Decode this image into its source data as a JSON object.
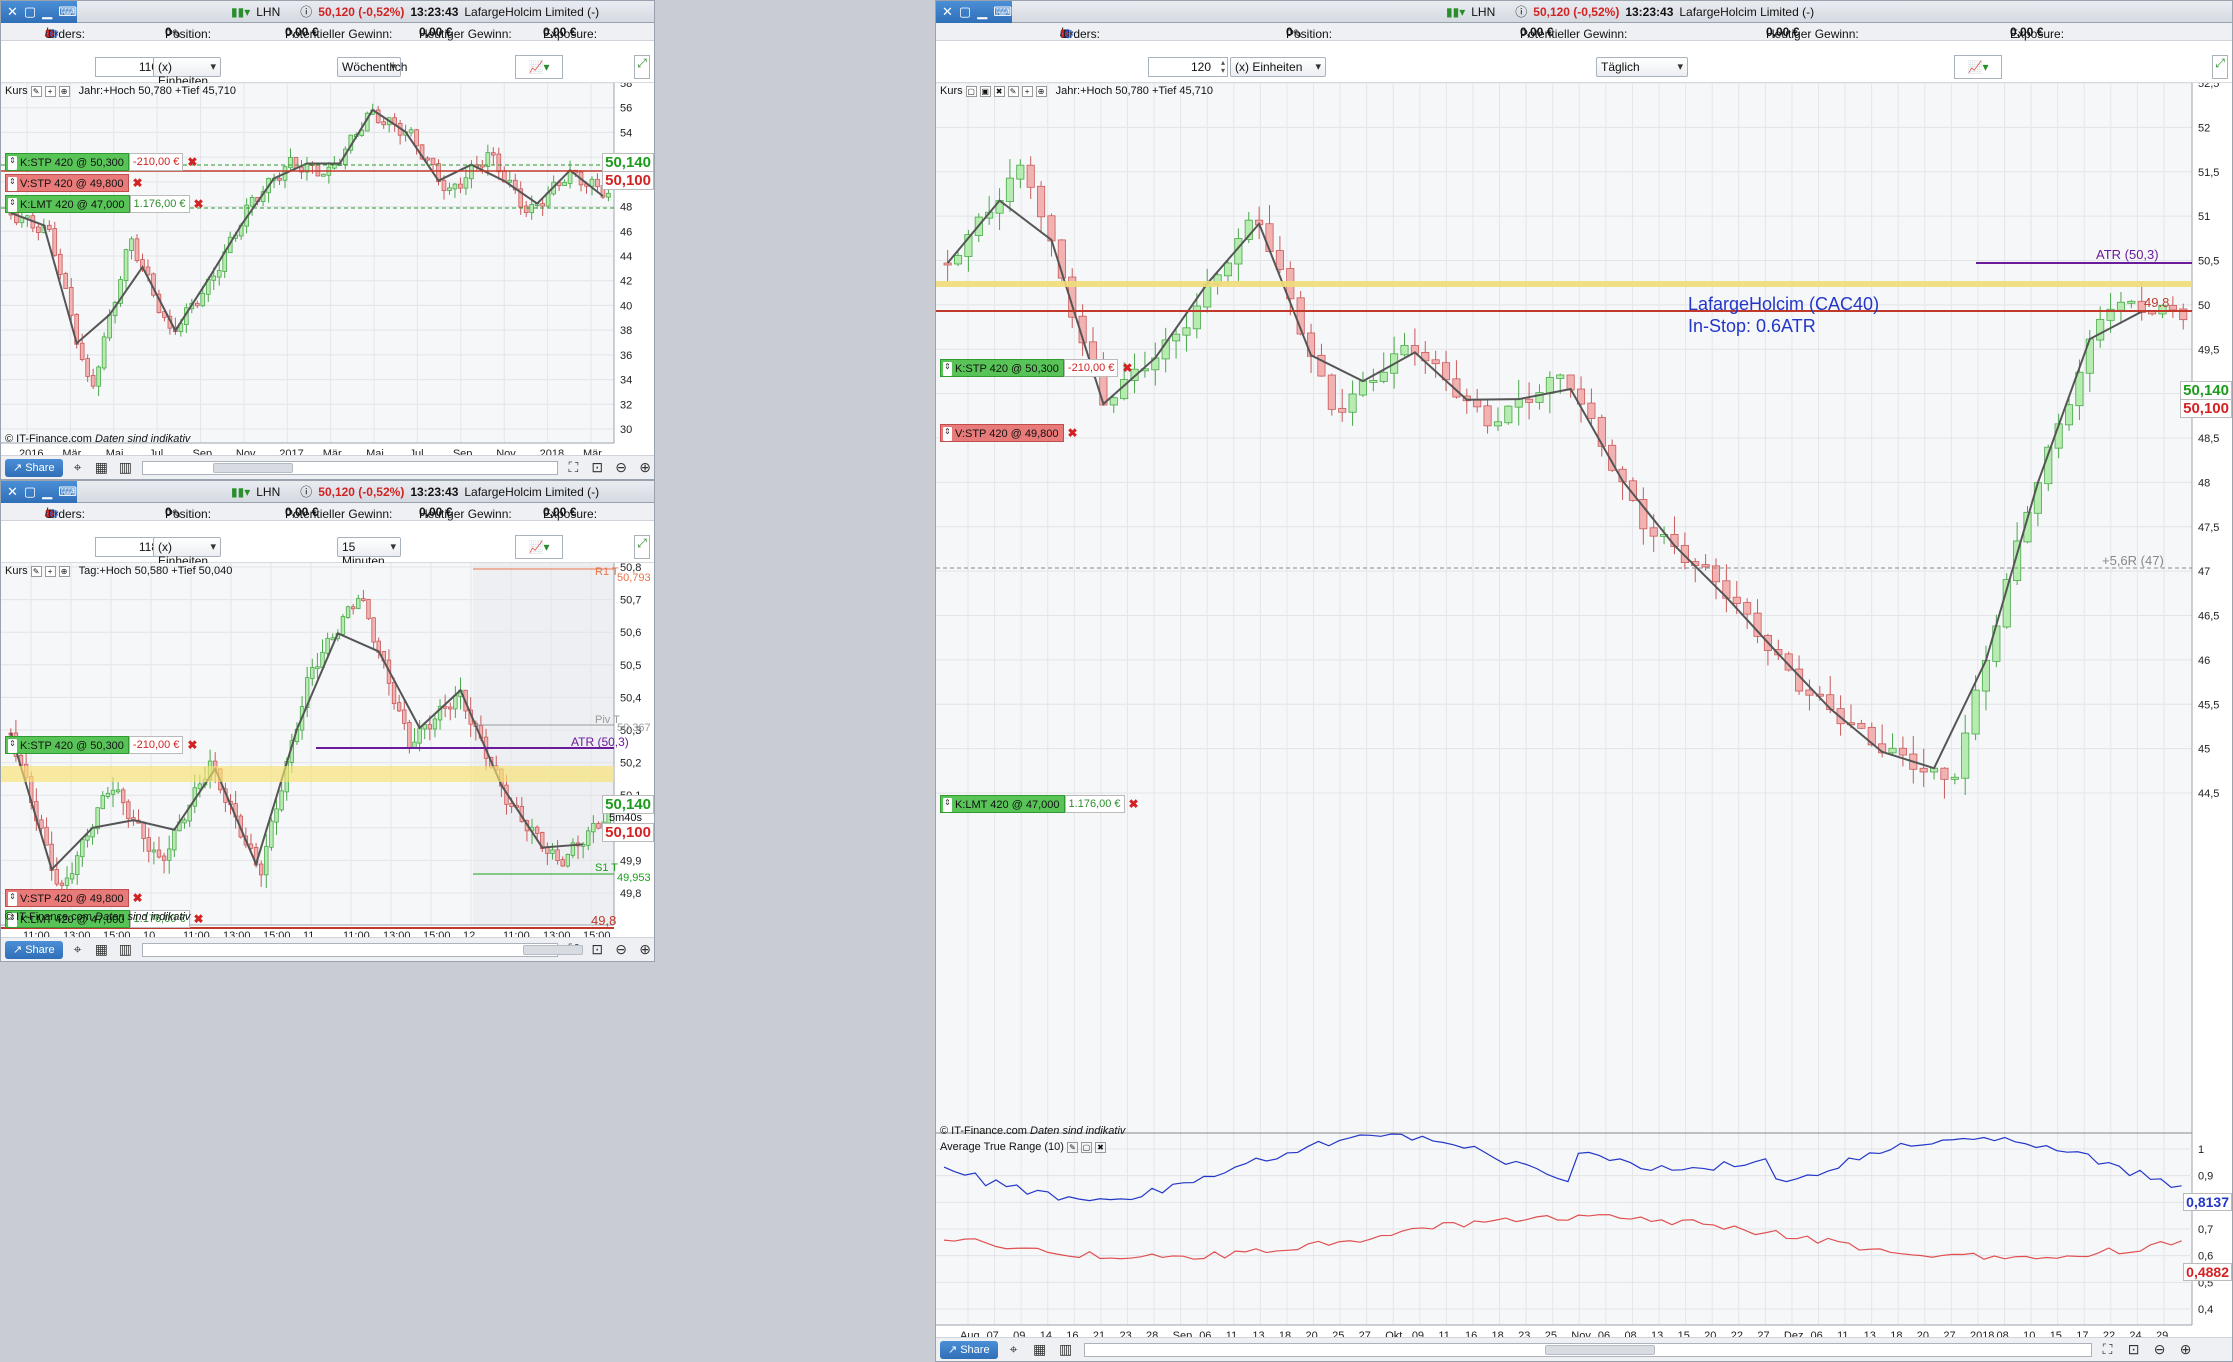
{
  "common": {
    "symbol": "LHN",
    "price": "50,120 (-0,52%)",
    "time": "13:23:43",
    "name": "LafargeHolcim Limited (-)",
    "orders_label": "Orders:",
    "orders_count": "3",
    "orders_zero": "0",
    "position_label": "Position:",
    "position_value": "0",
    "pot_gewinn_label": "Potentieller Gewinn:",
    "pot_gewinn_value": "0,00 €",
    "heute_label": "Heutiger Gewinn:",
    "heute_value": "0,00 €",
    "exposure_label": "Exposure:",
    "exposure_value": "0,00 €",
    "units_label": "(x) Einheiten",
    "kurs_label": "Kurs",
    "share_label": "Share",
    "copyright": "© IT-Finance.com",
    "copyright_note": "Daten sind indikativ",
    "k_stp": "K:STP  420 @ 50,300",
    "k_stp_pnl": "-210,00 €",
    "v_stp": "V:STP  420 @ 49,800",
    "k_lmt": "K:LMT  420 @ 47,000",
    "k_lmt_pnl": "1.176,00 €",
    "price_green": "50,140",
    "price_red": "50,100"
  },
  "pane_weekly": {
    "units_value": "110",
    "timeframe": "Wöchentlich",
    "hilo": "Jahr:+Hoch 50,780 +Tief 45,710",
    "y_ticks": [
      "58",
      "56",
      "54",
      "52",
      "50",
      "48",
      "46",
      "44",
      "42",
      "40",
      "38",
      "36",
      "34",
      "32",
      "30"
    ],
    "x_ticks": [
      "2016",
      "Mär",
      "Mai",
      "Jul",
      "Sep",
      "Nov",
      "2017",
      "Mär",
      "Mai",
      "Jul",
      "Sep",
      "Nov",
      "2018",
      "Mär"
    ]
  },
  "pane_15m": {
    "units_value": "118",
    "timeframe": "15 Minuten",
    "hilo": "Tag:+Hoch 50,580 +Tief 50,040",
    "y_ticks": [
      "50,8",
      "50,7",
      "50,6",
      "50,5",
      "50,4",
      "50,3",
      "50,2",
      "50,1",
      "50",
      "49,9",
      "49,8"
    ],
    "x_ticks": [
      "11:00",
      "13:00",
      "15:00",
      "10",
      "11:00",
      "13:00",
      "15:00",
      "11",
      "11:00",
      "13:00",
      "15:00",
      "12",
      "11:00",
      "13:00",
      "15:00"
    ],
    "r1_label": "R1 T",
    "r1_value": "50,793",
    "piv_label": "Piv T",
    "piv_value": "50,367",
    "atr_label": "ATR (50,3)",
    "s1_label": "S1 T",
    "s1_value": "49,953",
    "countdown": "5m40s",
    "stop_level": "49,8"
  },
  "pane_daily": {
    "units_value": "120",
    "timeframe": "Täglich",
    "hilo": "Jahr:+Hoch 50,780 +Tief 45,710",
    "title": "LafargeHolcim (CAC40)",
    "subtitle": "In-Stop: 0.6ATR",
    "atr_label": "ATR (50,3)",
    "stop_level": "49.8",
    "target_label": "+5,6R (47)",
    "y_ticks": [
      "52,5",
      "52",
      "51,5",
      "51",
      "50,5",
      "50",
      "49,5",
      "49",
      "48,5",
      "48",
      "47,5",
      "47",
      "46,5",
      "46",
      "45,5",
      "45",
      "44,5"
    ],
    "x_ticks": [
      "Aug",
      "07",
      "09",
      "14",
      "16",
      "21",
      "23",
      "28",
      "Sep",
      "06",
      "11",
      "13",
      "18",
      "20",
      "25",
      "27",
      "Okt",
      "09",
      "11",
      "16",
      "18",
      "23",
      "25",
      "Nov",
      "06",
      "08",
      "13",
      "15",
      "20",
      "22",
      "27",
      "Dez",
      "06",
      "11",
      "13",
      "18",
      "20",
      "27",
      "2018",
      "08",
      "10",
      "15",
      "17",
      "22",
      "24",
      "29"
    ],
    "atr_indicator": "Average True Range (10)",
    "atr_ticks": [
      "1",
      "0,9",
      "0,8",
      "0,7",
      "0,6",
      "0,5",
      "0,4"
    ],
    "atr_value_blue": "0,8137",
    "atr_value_red": "0,4882"
  }
}
